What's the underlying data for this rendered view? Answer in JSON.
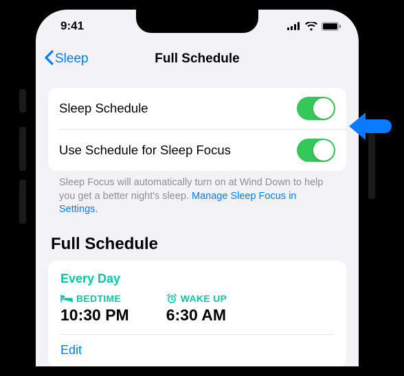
{
  "statusbar": {
    "time": "9:41"
  },
  "nav": {
    "back": "Sleep",
    "title": "Full Schedule"
  },
  "toggles": {
    "sleep_schedule_label": "Sleep Schedule",
    "sleep_schedule_on": true,
    "use_focus_label": "Use Schedule for Sleep Focus",
    "use_focus_on": true
  },
  "footer": {
    "text": "Sleep Focus will automatically turn on at Wind Down to help you get a better night's sleep. ",
    "link": "Manage Sleep Focus in Settings."
  },
  "section": {
    "title": "Full Schedule"
  },
  "schedule": {
    "frequency": "Every Day",
    "bedtime_label": "BEDTIME",
    "bedtime_value": "10:30 PM",
    "wake_label": "WAKE UP",
    "wake_value": "6:30 AM",
    "edit": "Edit"
  },
  "colors": {
    "link": "#007aff",
    "accent_green": "#34c759",
    "teal": "#00c7a6"
  }
}
